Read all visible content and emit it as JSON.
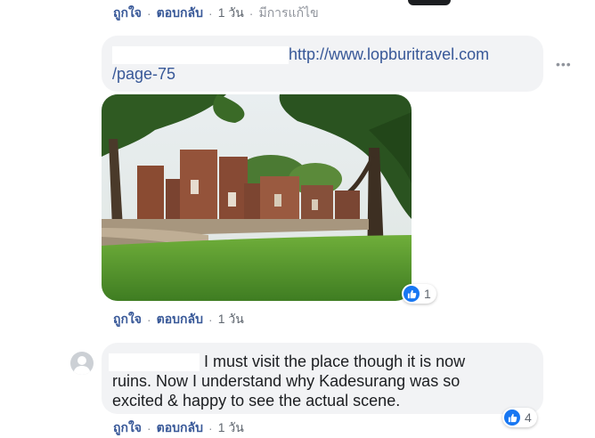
{
  "top_actions": {
    "like": "ถูกใจ",
    "reply": "ตอบกลับ",
    "time": "1 วัน",
    "edited": "มีการแก้ไข"
  },
  "link_comment": {
    "url_line1": "http://www.lopburitravel.com",
    "url_line2": "/page-75",
    "more_icon": "more-horizontal-icon"
  },
  "photo_reaction": {
    "icon": "like-icon",
    "count": "1"
  },
  "mid_actions": {
    "like": "ถูกใจ",
    "reply": "ตอบกลับ",
    "time": "1 วัน"
  },
  "comment": {
    "text_line1": "I must visit the place though it is now",
    "text_line2": "ruins. Now I understand why Kadesurang was so",
    "text_line3": "excited & happy to see the actual scene.",
    "reaction_icon": "like-icon",
    "reaction_count": "4"
  },
  "bottom_actions": {
    "like": "ถูกใจ",
    "reply": "ตอบกลับ",
    "time": "1 วัน"
  },
  "colors": {
    "link": "#385898",
    "bubble": "#f2f3f5",
    "like_blue": "#1877f2",
    "meta": "#606770"
  }
}
